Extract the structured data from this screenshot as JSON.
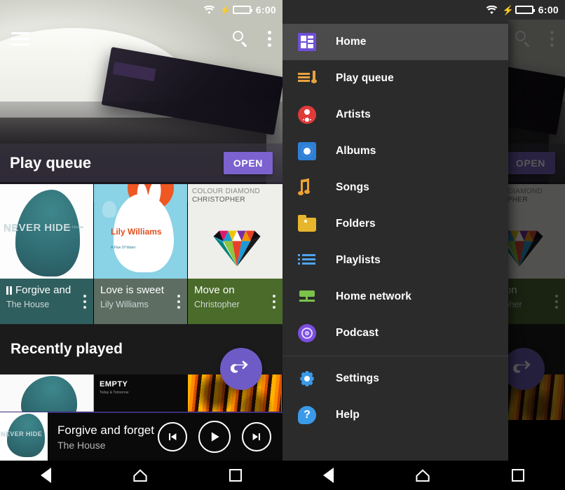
{
  "status_bar": {
    "time": "6:00",
    "wifi_icon": "wifi-icon",
    "battery_icon": "battery-charging-icon"
  },
  "toolbar": {
    "menu_icon": "hamburger-menu-icon",
    "search_icon": "search-icon",
    "overflow_icon": "more-vert-icon"
  },
  "hero": {
    "section_title": "Play queue",
    "open_button": "OPEN"
  },
  "albums": [
    {
      "title": "Forgive and",
      "artist": "The House",
      "playing": true,
      "art": {
        "caption": "NEVER HIDE",
        "sub": "The House"
      },
      "tile_color": "#2f5e5e"
    },
    {
      "title": "Love is sweet",
      "artist": "Lily Williams",
      "playing": false,
      "art": {
        "caption": "Lily Williams",
        "sub": "A Paw Of Water"
      },
      "tile_color": "#5d6d62"
    },
    {
      "title": "Move on",
      "artist": "Christopher",
      "playing": false,
      "art": {
        "caption": "COLOUR DIAMOND",
        "sub": "CHRISTOPHER"
      },
      "tile_color": "#4a6b2a"
    }
  ],
  "recently_played": {
    "title": "Recently played",
    "items": [
      {
        "label": ""
      },
      {
        "label": "EMPTY",
        "sub": "Today & Tomorrow"
      },
      {
        "label": ""
      }
    ],
    "fab_icon": "repeat-icon"
  },
  "player": {
    "title": "Forgive and forget",
    "artist": "The House",
    "prev_icon": "skip-previous-icon",
    "play_icon": "play-icon",
    "next_icon": "skip-next-icon"
  },
  "navbar": {
    "back_icon": "back-triangle-icon",
    "home_icon": "home-icon",
    "recents_icon": "recents-square-icon"
  },
  "drawer": {
    "items": [
      {
        "label": "Home",
        "icon": "home-grid-icon",
        "active": true
      },
      {
        "label": "Play queue",
        "icon": "play-queue-icon",
        "active": false
      },
      {
        "label": "Artists",
        "icon": "artists-icon",
        "active": false
      },
      {
        "label": "Albums",
        "icon": "albums-icon",
        "active": false
      },
      {
        "label": "Songs",
        "icon": "songs-note-icon",
        "active": false
      },
      {
        "label": "Folders",
        "icon": "folders-icon",
        "active": false
      },
      {
        "label": "Playlists",
        "icon": "playlists-icon",
        "active": false
      },
      {
        "label": "Home network",
        "icon": "home-network-icon",
        "active": false
      },
      {
        "label": "Podcast",
        "icon": "podcast-icon",
        "active": false
      }
    ],
    "footer_items": [
      {
        "label": "Settings",
        "icon": "settings-gear-icon"
      },
      {
        "label": "Help",
        "icon": "help-icon"
      }
    ]
  },
  "colors": {
    "accent_purple": "#6e5bc6",
    "open_button": "#7b62cf",
    "drawer_bg": "#2b2b2b",
    "drawer_active": "#4b4b4b"
  }
}
